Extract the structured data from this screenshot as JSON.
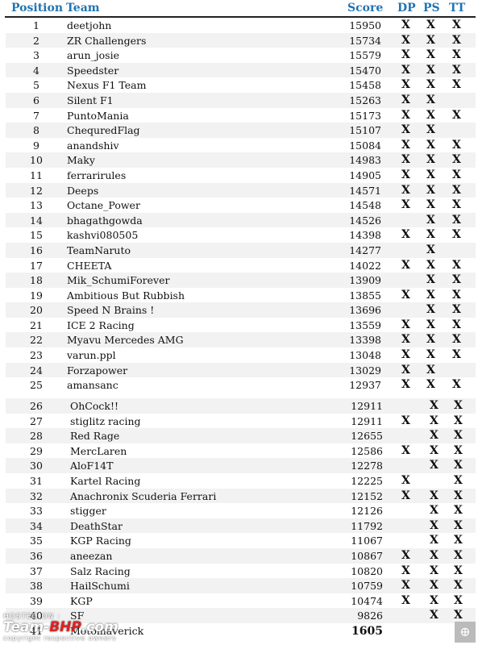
{
  "headers": {
    "position": "Position",
    "team": "Team",
    "score": "Score",
    "dp": "DP",
    "ps": "PS",
    "tt": "TT"
  },
  "mark": "X",
  "rows": [
    {
      "pos": "1",
      "team": "deetjohn",
      "score": "15950",
      "dp": true,
      "ps": true,
      "tt": true
    },
    {
      "pos": "2",
      "team": "ZR Challengers",
      "score": "15734",
      "dp": true,
      "ps": true,
      "tt": true
    },
    {
      "pos": "3",
      "team": "arun_josie",
      "score": "15579",
      "dp": true,
      "ps": true,
      "tt": true
    },
    {
      "pos": "4",
      "team": "Speedster",
      "score": "15470",
      "dp": true,
      "ps": true,
      "tt": true
    },
    {
      "pos": "5",
      "team": "Nexus F1 Team",
      "score": "15458",
      "dp": true,
      "ps": true,
      "tt": true
    },
    {
      "pos": "6",
      "team": "Silent F1",
      "score": "15263",
      "dp": true,
      "ps": true,
      "tt": false
    },
    {
      "pos": "7",
      "team": "PuntoMania",
      "score": "15173",
      "dp": true,
      "ps": true,
      "tt": true
    },
    {
      "pos": "8",
      "team": "ChequredFlag",
      "score": "15107",
      "dp": true,
      "ps": true,
      "tt": false
    },
    {
      "pos": "9",
      "team": "anandshiv",
      "score": "15084",
      "dp": true,
      "ps": true,
      "tt": true
    },
    {
      "pos": "10",
      "team": "Maky",
      "score": "14983",
      "dp": true,
      "ps": true,
      "tt": true
    },
    {
      "pos": "11",
      "team": "ferrarirules",
      "score": "14905",
      "dp": true,
      "ps": true,
      "tt": true
    },
    {
      "pos": "12",
      "team": "Deeps",
      "score": "14571",
      "dp": true,
      "ps": true,
      "tt": true
    },
    {
      "pos": "13",
      "team": "Octane_Power",
      "score": "14548",
      "dp": true,
      "ps": true,
      "tt": true
    },
    {
      "pos": "14",
      "team": "bhagathgowda",
      "score": "14526",
      "dp": false,
      "ps": true,
      "tt": true
    },
    {
      "pos": "15",
      "team": "kashvi080505",
      "score": "14398",
      "dp": true,
      "ps": true,
      "tt": true
    },
    {
      "pos": "16",
      "team": "TeamNaruto",
      "score": "14277",
      "dp": false,
      "ps": true,
      "tt": false
    },
    {
      "pos": "17",
      "team": "CHEETA",
      "score": "14022",
      "dp": true,
      "ps": true,
      "tt": true
    },
    {
      "pos": "18",
      "team": "Mik_SchumiForever",
      "score": "13909",
      "dp": false,
      "ps": true,
      "tt": true
    },
    {
      "pos": "19",
      "team": "Ambitious But Rubbish",
      "score": "13855",
      "dp": true,
      "ps": true,
      "tt": true
    },
    {
      "pos": "20",
      "team": "Speed N Brains !",
      "score": "13696",
      "dp": false,
      "ps": true,
      "tt": true
    },
    {
      "pos": "21",
      "team": "ICE 2 Racing",
      "score": "13559",
      "dp": true,
      "ps": true,
      "tt": true
    },
    {
      "pos": "22",
      "team": "Myavu Mercedes AMG",
      "score": "13398",
      "dp": true,
      "ps": true,
      "tt": true
    },
    {
      "pos": "23",
      "team": "varun.ppl",
      "score": "13048",
      "dp": true,
      "ps": true,
      "tt": true
    },
    {
      "pos": "24",
      "team": "Forzapower",
      "score": "13029",
      "dp": true,
      "ps": true,
      "tt": false
    },
    {
      "pos": "25",
      "team": "amansanc",
      "score": "12937",
      "dp": true,
      "ps": true,
      "tt": true
    },
    {
      "pos": "26",
      "team": "OhCock!!",
      "score": "12911",
      "dp": false,
      "ps": true,
      "tt": true
    },
    {
      "pos": "27",
      "team": "stiglitz racing",
      "score": "12911",
      "dp": true,
      "ps": true,
      "tt": true
    },
    {
      "pos": "28",
      "team": "Red Rage",
      "score": "12655",
      "dp": false,
      "ps": true,
      "tt": true
    },
    {
      "pos": "29",
      "team": "MercLaren",
      "score": "12586",
      "dp": true,
      "ps": true,
      "tt": true
    },
    {
      "pos": "30",
      "team": "AloF14T",
      "score": "12278",
      "dp": false,
      "ps": true,
      "tt": true
    },
    {
      "pos": "31",
      "team": "Kartel Racing",
      "score": "12225",
      "dp": true,
      "ps": false,
      "tt": true
    },
    {
      "pos": "32",
      "team": "Anachronix Scuderia Ferrari",
      "score": "12152",
      "dp": true,
      "ps": true,
      "tt": true
    },
    {
      "pos": "33",
      "team": "stigger",
      "score": "12126",
      "dp": false,
      "ps": true,
      "tt": true
    },
    {
      "pos": "34",
      "team": "DeathStar",
      "score": "11792",
      "dp": false,
      "ps": true,
      "tt": true
    },
    {
      "pos": "35",
      "team": "KGP Racing",
      "score": "11067",
      "dp": false,
      "ps": true,
      "tt": true
    },
    {
      "pos": "36",
      "team": "aneezan",
      "score": "10867",
      "dp": true,
      "ps": true,
      "tt": true
    },
    {
      "pos": "37",
      "team": "Salz Racing",
      "score": "10820",
      "dp": true,
      "ps": true,
      "tt": true
    },
    {
      "pos": "38",
      "team": "HailSchumi",
      "score": "10759",
      "dp": true,
      "ps": true,
      "tt": true
    },
    {
      "pos": "39",
      "team": "KGP",
      "score": "10474",
      "dp": true,
      "ps": true,
      "tt": true
    },
    {
      "pos": "40",
      "team": "SF",
      "score": "9826",
      "dp": false,
      "ps": true,
      "tt": true
    },
    {
      "pos": "41",
      "team": "Motomaverick",
      "score": "1605",
      "dp": false,
      "ps": false,
      "tt": false,
      "bold": true
    }
  ],
  "watermark": {
    "hosted": "HOSTED ON :",
    "logo_a": "Team-",
    "logo_b": "BHP",
    "logo_c": ".com",
    "copyright": "copyright respective owners"
  },
  "zoom_icon": "magnifier-plus-icon"
}
